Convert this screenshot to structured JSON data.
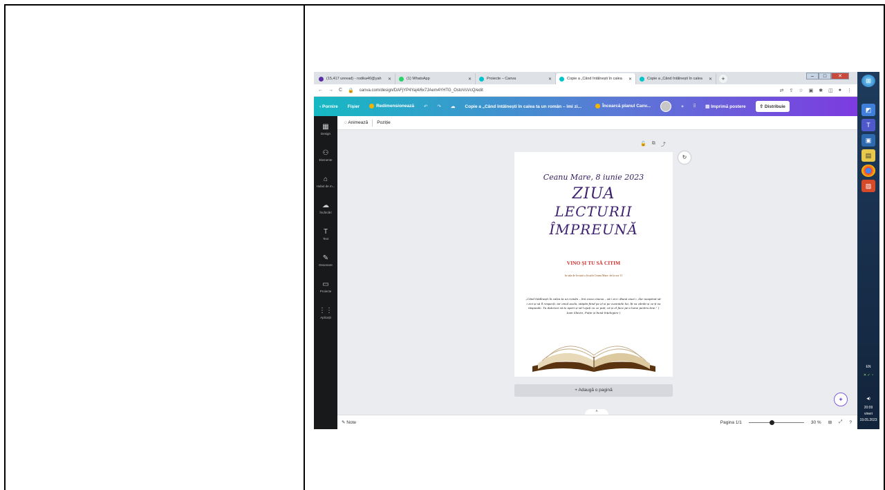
{
  "browser": {
    "tabs": [
      {
        "label": "(15,417 unread) - rodika40@yah",
        "color": "#5b2fa8"
      },
      {
        "label": "(1) WhatsApp",
        "color": "#25d366"
      },
      {
        "label": "Proiecte – Canva",
        "color": "#00c4cc"
      },
      {
        "label": "Copie a „Când întâlnești în calea",
        "color": "#00c4cc"
      },
      {
        "label": "Copie a „Când întâlnești în calea",
        "color": "#00c4cc"
      }
    ],
    "new_tab": "+",
    "url": "canva.com/design/DAFjYP4Yaj4/6x7JAem4YHTG_OstoVsVcQ/edit"
  },
  "canva": {
    "home": "Pornire",
    "file": "Fișier",
    "resize": "Redimensionează",
    "title": "Copie a „Când întâlnești în calea ta un român – îmi zi...",
    "try_plan": "Încearcă planul Canv...",
    "plus": "+",
    "print": "Imprimă postere",
    "share": "Distribuie",
    "animate": "Animează",
    "position": "Poziție",
    "nav": [
      {
        "icon": "▦",
        "label": "Design"
      },
      {
        "icon": "⚇",
        "label": "Elemente"
      },
      {
        "icon": "⌂",
        "label": "Hubul de m..."
      },
      {
        "icon": "☁",
        "label": "Încărcări"
      },
      {
        "icon": "T",
        "label": "Text"
      },
      {
        "icon": "✎",
        "label": "Desenare"
      },
      {
        "icon": "▭",
        "label": "Proiecte"
      },
      {
        "icon": "⋮⋮",
        "label": "Aplicații"
      }
    ],
    "add_page": "+ Adaugă o pagină",
    "notes": "Note",
    "page_counter": "Pagina 1/1",
    "zoom": "30 %"
  },
  "poster": {
    "date": "Ceanu Mare, 8 iunie 2023",
    "line1": "ZIUA",
    "line2": "LECTURII",
    "line3": "ÎMPREUNĂ",
    "red": "VINO ȘI TU SĂ CITIM",
    "small": "în sala de lectură a Școalii Ceanu Mare, de la ora 11",
    "quote": "„Când întâlnești în calea ta un român – îmi zicea cineva – să-i zici «Bună ziua!», dar neapărat să-i zici și să îl respecți, iar omul acela, stăpân fiind pe el și pe cuvintele lui, îți va zâmbi și ce-ți va răspunde. Tu datorezi să te aperi și să-l ajuți cu ce poți, că și el face pe-o lume pentru tine.” ( Ioan Slavici, Puțin și bună înțelegere )"
  },
  "taskbar": {
    "lang": "EN",
    "time": "20:09",
    "day": "vineri",
    "date": "19.05.2023"
  }
}
